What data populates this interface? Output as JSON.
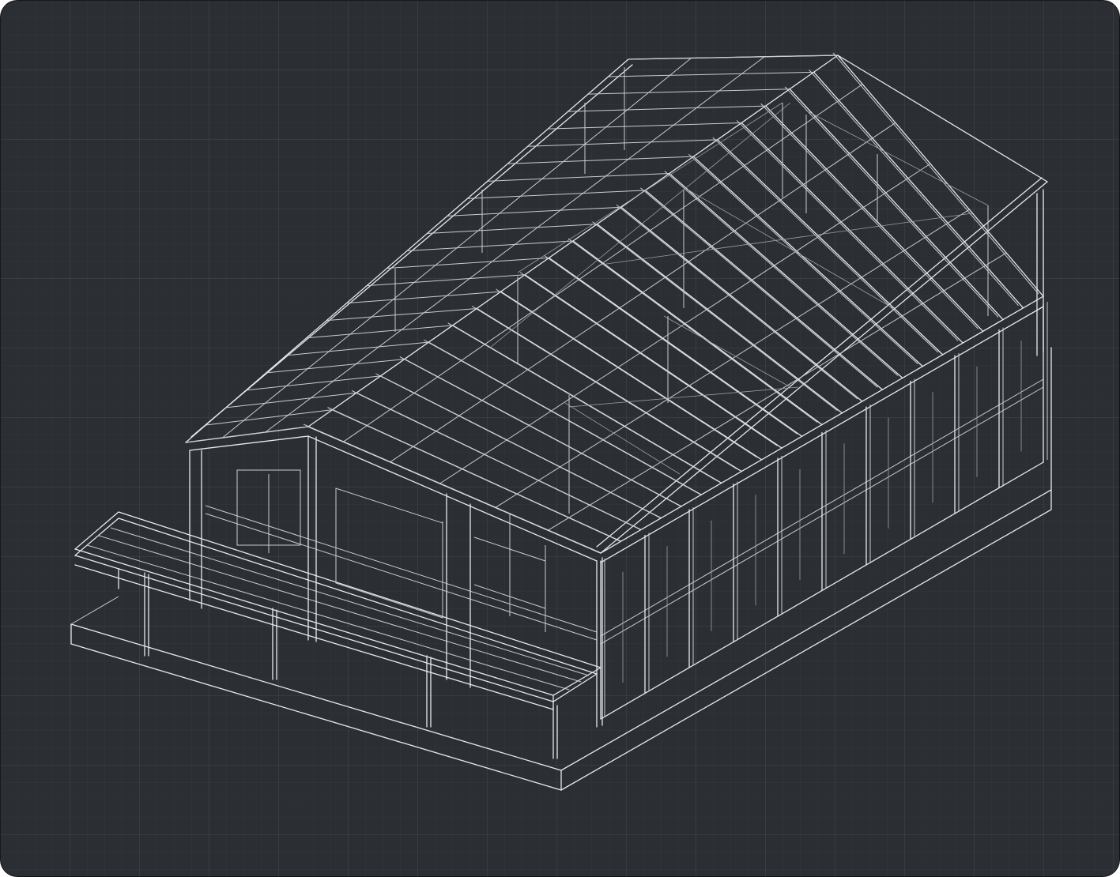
{
  "canvas": {
    "background_color": "#2b2f34",
    "line_color": "#e6e9ec",
    "grid_color": "#3a3f45"
  },
  "drawing": {
    "subject": "isometric-steel-frame-building-wireframe",
    "roof_rafter_count": 22,
    "front_wall_bays": 5,
    "side_wall_bays": 10,
    "canopy_post_count": 6
  }
}
